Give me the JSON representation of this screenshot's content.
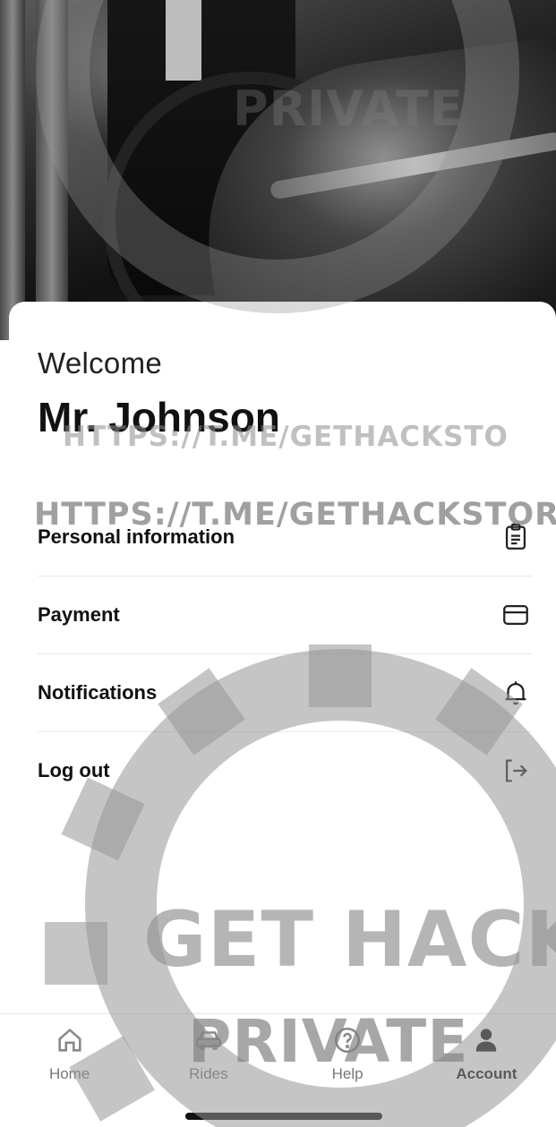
{
  "header": {
    "welcome": "Welcome",
    "name": "Mr. Johnson"
  },
  "menu": [
    {
      "label": "Personal information",
      "icon": "clipboard-icon"
    },
    {
      "label": "Payment",
      "icon": "credit-card-icon"
    },
    {
      "label": "Notifications",
      "icon": "bell-icon"
    },
    {
      "label": "Log out",
      "icon": "logout-icon"
    }
  ],
  "tabbar": {
    "tabs": [
      {
        "label": "Home",
        "icon": "home-icon",
        "active": false
      },
      {
        "label": "Rides",
        "icon": "car-icon",
        "active": false
      },
      {
        "label": "Help",
        "icon": "help-icon",
        "active": false
      },
      {
        "label": "Account",
        "icon": "person-icon",
        "active": true
      }
    ]
  },
  "watermark": {
    "link": "HTTPS://T.ME/GETHACKSTOR",
    "link_short": "HTTPS://T.ME/GETHACKSTO",
    "brand_top": "GET HACK",
    "brand_bottom": "PRIVATE"
  },
  "colors": {
    "text_primary": "#111111",
    "tab_inactive": "#777777",
    "divider": "#e9e9e9"
  }
}
